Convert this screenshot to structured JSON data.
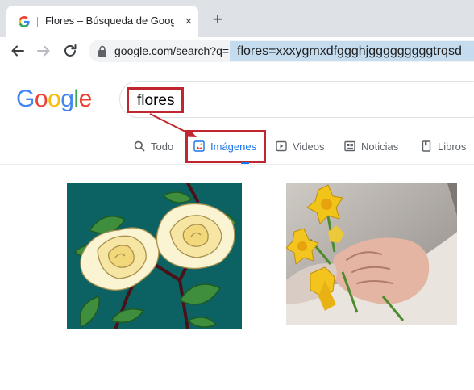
{
  "browser": {
    "tab": {
      "title": "Flores – Búsqueda de Google",
      "favicon": "google-g-icon",
      "close": "×"
    },
    "new_tab": "+",
    "address": {
      "url": "google.com/search?q=",
      "callout_text": "flores=xxxygmxdfggghjgggggggggtrqsd"
    }
  },
  "google": {
    "logo_letters": [
      "G",
      "o",
      "o",
      "g",
      "l",
      "e"
    ],
    "logo_colors": [
      "#4285f4",
      "#ea4335",
      "#fbbc05",
      "#4285f4",
      "#34a853",
      "#ea4335"
    ],
    "query": "flores"
  },
  "result_tabs": [
    {
      "label": "Todo",
      "icon": "search-icon",
      "active": false
    },
    {
      "label": "Imágenes",
      "icon": "image-icon",
      "active": true
    },
    {
      "label": "Videos",
      "icon": "play-icon",
      "active": false
    },
    {
      "label": "Noticias",
      "icon": "news-icon",
      "active": false
    },
    {
      "label": "Libros",
      "icon": "book-icon",
      "active": false
    }
  ],
  "colors": {
    "annotation": "#c0262d",
    "link_blue": "#1a73e8",
    "address_highlight": "#c5dcef"
  },
  "results": [
    {
      "name": "white-roses-illustration"
    },
    {
      "name": "daffodils-in-hands-photo"
    }
  ]
}
